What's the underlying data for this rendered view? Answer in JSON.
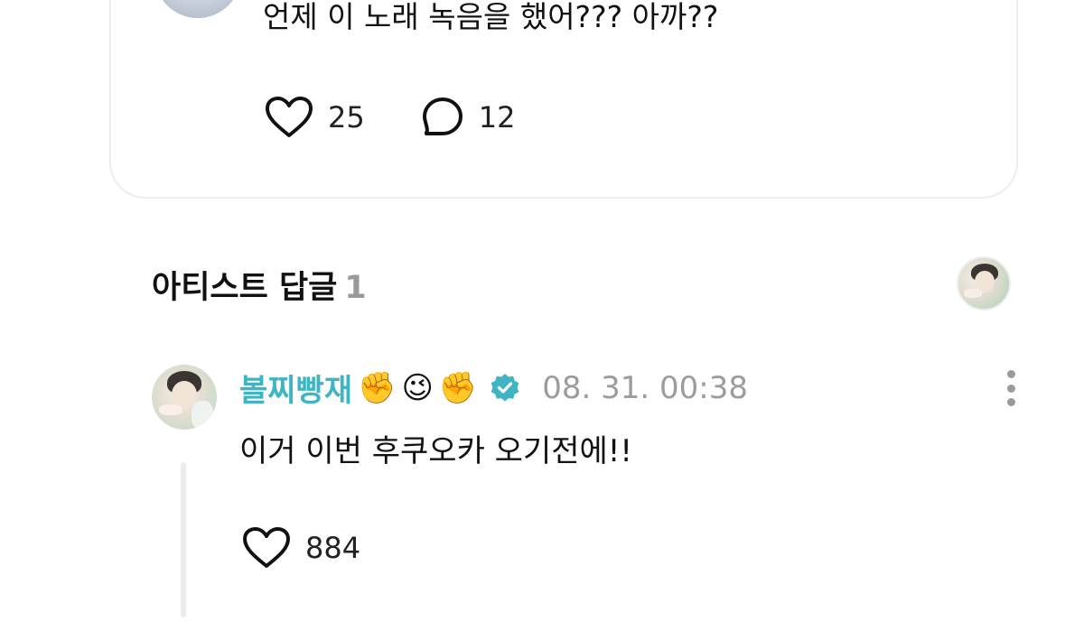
{
  "comment": {
    "text": "언제 이 노래 녹음을 했어??? 아까??",
    "likes": "25",
    "replies": "12"
  },
  "artist_replies": {
    "title": "아티스트 답글",
    "count": "1"
  },
  "reply": {
    "author": "볼찌빵재",
    "emojis": [
      "✊",
      "😉",
      "✊"
    ],
    "timestamp": "08. 31. 00:38",
    "text": "이거 이번 후쿠오카 오기전에!!",
    "likes": "884"
  },
  "colors": {
    "accent": "#3fb5c4",
    "muted": "#9c9c9c",
    "border": "#ededed"
  },
  "icons": {
    "like": "heart-icon",
    "reply": "speech-bubble-icon",
    "verified": "verified-badge-icon",
    "more": "more-vertical-icon"
  }
}
